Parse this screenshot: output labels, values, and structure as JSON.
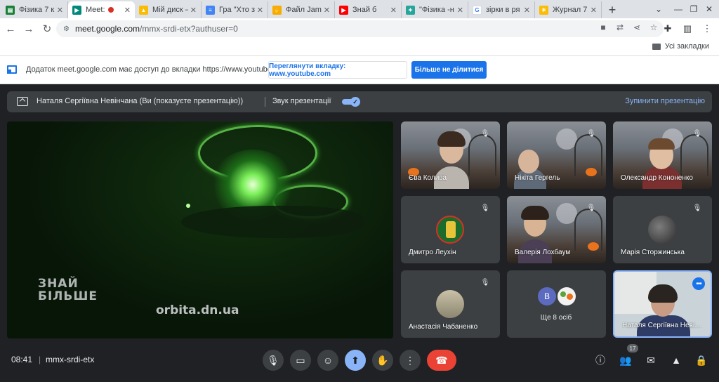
{
  "browser": {
    "tabs": [
      {
        "label": "Фізика 7 к",
        "favicon_color": "#188038",
        "favicon_glyph": "▤",
        "active": false
      },
      {
        "label": "Meet: ",
        "favicon_color": "#00897b",
        "favicon_glyph": "▶",
        "active": true,
        "recording": true
      },
      {
        "label": "Мій диск –",
        "favicon_color": "#fbbc04",
        "favicon_glyph": "▲",
        "active": false
      },
      {
        "label": "Гра \"Хто з",
        "favicon_color": "#4285f4",
        "favicon_glyph": "≡",
        "active": false
      },
      {
        "label": "Файл Jam",
        "favicon_color": "#f9ab00",
        "favicon_glyph": "✋",
        "active": false
      },
      {
        "label": "Знай б",
        "favicon_color": "#ff0000",
        "favicon_glyph": "▶",
        "active": false
      },
      {
        "label": "\"Фізика -н",
        "favicon_color": "#26a69a",
        "favicon_glyph": "✦",
        "active": false
      },
      {
        "label": "зірки в ря",
        "favicon_color": "#ffffff",
        "favicon_glyph": "G",
        "active": false
      },
      {
        "label": "Журнал 7",
        "favicon_color": "#fbbc04",
        "favicon_glyph": "☀",
        "active": false
      }
    ],
    "url_host": "meet.google.com",
    "url_path": "/mmx-srdi-etx?authuser=0",
    "bookmarks_all": "Усі закладки"
  },
  "share_bar": {
    "text": "Додаток meet.google.com має доступ до вкладки https://www.youtube.com",
    "view_tab_label": "Переглянути вкладку: www.youtube.com",
    "stop_sharing_label": "Більше не ділитися"
  },
  "presenting": {
    "text": "Наталя Сергіївна Невінчана (Ви (показуєте презентацію))",
    "audio_label": "Звук презентації",
    "audio_on": true,
    "stop_label": "Зупинити презентацію"
  },
  "stage": {
    "logo_line1": "ЗНАЙ",
    "logo_line2": "БІЛЬШЕ",
    "watermark": "orbita.dn.ua"
  },
  "participants": [
    {
      "name": "Єва Колива",
      "muted": true
    },
    {
      "name": "Нікіта Гергель",
      "muted": true
    },
    {
      "name": "Олександр Кононенко",
      "muted": true
    },
    {
      "name": "Дмитро Леухін",
      "muted": true
    },
    {
      "name": "Валерія Лохбаум",
      "muted": true
    },
    {
      "name": "Марія Сторжинська",
      "muted": true
    },
    {
      "name": "Анастасія Чабаненко",
      "muted": true
    },
    {
      "name": "Наталя Сергіївна Невінчана",
      "muted": false
    }
  ],
  "more_tile": {
    "avatar_letter": "В",
    "label": "Ще 8 осіб"
  },
  "bottom": {
    "time": "08:41",
    "meeting_code": "mmx-srdi-etx",
    "people_count": "17"
  },
  "colors": {
    "accent": "#8ab4f8",
    "hangup": "#ea4335",
    "primary_button": "#1a73e8"
  }
}
